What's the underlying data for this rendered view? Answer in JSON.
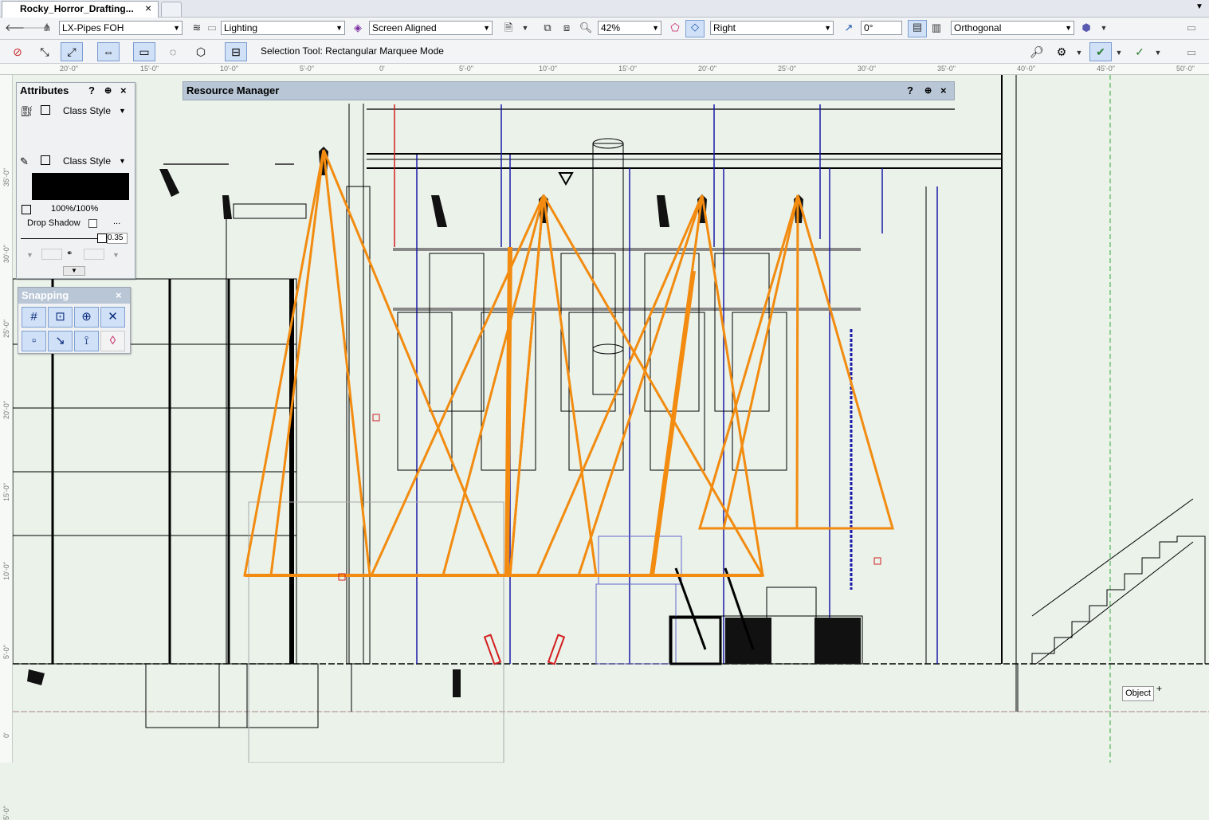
{
  "tab": {
    "title": "Rocky_Horror_Drafting...",
    "close": "×"
  },
  "viewbar": {
    "class_value": "LX-Pipes FOH",
    "layer_value": "Lighting",
    "plane_value": "Screen Aligned",
    "zoom_value": "42%",
    "view_value": "Right",
    "rotation_value": "0°",
    "projection_value": "Orthogonal"
  },
  "toolbar": {
    "status": "Selection Tool: Rectangular Marquee Mode"
  },
  "ruler": {
    "top": [
      "20'-0\"",
      "15'-0\"",
      "10'-0\"",
      "5'-0\"",
      "0'",
      "5'-0\"",
      "10'-0\"",
      "15'-0\"",
      "20'-0\"",
      "25'-0\"",
      "30'-0\"",
      "35'-0\"",
      "40'-0\"",
      "45'-0\"",
      "50'-0\""
    ],
    "left": [
      "35'-0\"",
      "30'-0\"",
      "25'-0\"",
      "20'-0\"",
      "15'-0\"",
      "10'-0\"",
      "5'-0\"",
      "0'",
      "5'-0\""
    ]
  },
  "attributes": {
    "title": "Attributes",
    "help": "?",
    "close": "×",
    "fill_style": "Class Style",
    "pen_style": "Class Style",
    "opacity": "100%/100%",
    "drop_shadow": "Drop Shadow",
    "ellipsis": "...",
    "line_weight": "0.35"
  },
  "snapping": {
    "title": "Snapping",
    "close": "×"
  },
  "resource_manager": {
    "title": "Resource Manager",
    "help": "?",
    "close": "×"
  },
  "tooltip": {
    "object": "Object"
  },
  "colors": {
    "beam": "#f28b0f",
    "pipe": "#1a1aa8",
    "accent": "#d32020"
  }
}
